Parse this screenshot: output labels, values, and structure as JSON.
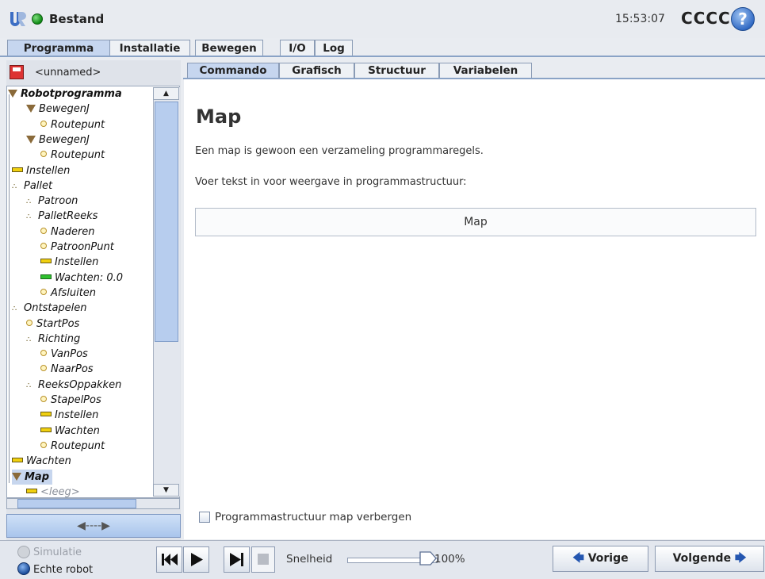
{
  "header": {
    "app_title": "Bestand",
    "clock": "15:53:07",
    "robot_name": "CCCC",
    "help_symbol": "?"
  },
  "main_tabs": [
    {
      "label": "Programma",
      "active": true
    },
    {
      "label": "Installatie",
      "active": false
    },
    {
      "label": "Bewegen",
      "active": false
    },
    {
      "label": "I/O",
      "active": false
    },
    {
      "label": "Log",
      "active": false
    }
  ],
  "program": {
    "name": "<unnamed>"
  },
  "tree": [
    {
      "label": "Robotprogramma",
      "icon": "triangle-icon",
      "bold": true
    },
    {
      "label": "BewegenJ",
      "icon": "triangle-icon"
    },
    {
      "label": "Routepunt",
      "icon": "waypoint-icon"
    },
    {
      "label": "BewegenJ",
      "icon": "triangle-icon"
    },
    {
      "label": "Routepunt",
      "icon": "waypoint-icon"
    },
    {
      "label": "Instellen",
      "icon": "set-icon"
    },
    {
      "label": "Pallet",
      "icon": "pallet-icon"
    },
    {
      "label": "Patroon",
      "icon": "pallet-icon"
    },
    {
      "label": "PalletReeks",
      "icon": "pallet-icon"
    },
    {
      "label": "Naderen",
      "icon": "waypoint-icon"
    },
    {
      "label": "PatroonPunt",
      "icon": "waypoint-icon"
    },
    {
      "label": "Instellen",
      "icon": "set-icon"
    },
    {
      "label": "Wachten: 0.0",
      "icon": "wait-icon"
    },
    {
      "label": "Afsluiten",
      "icon": "waypoint-icon"
    },
    {
      "label": "Ontstapelen",
      "icon": "pallet-icon"
    },
    {
      "label": "StartPos",
      "icon": "waypoint-icon"
    },
    {
      "label": "Richting",
      "icon": "pallet-icon"
    },
    {
      "label": "VanPos",
      "icon": "waypoint-icon"
    },
    {
      "label": "NaarPos",
      "icon": "waypoint-icon"
    },
    {
      "label": "ReeksOppakken",
      "icon": "pallet-icon"
    },
    {
      "label": "StapelPos",
      "icon": "waypoint-icon"
    },
    {
      "label": "Instellen",
      "icon": "set-icon"
    },
    {
      "label": "Wachten",
      "icon": "set-icon"
    },
    {
      "label": "Routepunt",
      "icon": "waypoint-icon"
    },
    {
      "label": "Wachten",
      "icon": "set-icon"
    },
    {
      "label": "Map",
      "icon": "triangle-icon",
      "bold": true,
      "selected": true
    },
    {
      "label": "<leeg>",
      "icon": "set-icon",
      "muted": true
    }
  ],
  "move_button_symbol": "◀----▶",
  "sub_tabs": [
    {
      "label": "Commando",
      "active": true
    },
    {
      "label": "Grafisch",
      "active": false
    },
    {
      "label": "Structuur",
      "active": false
    },
    {
      "label": "Variabelen",
      "active": false
    }
  ],
  "content": {
    "title": "Map",
    "description": "Een map is gewoon een verzameling programmaregels.",
    "prompt": "Voer tekst in voor weergave in programmastructuur:",
    "comment_value": "Map",
    "hide_checkbox_label": "Programmastructuur map verbergen",
    "hide_checked": false
  },
  "footer": {
    "simulation_label": "Simulatie",
    "real_robot_label": "Echte robot",
    "real_robot_selected": true,
    "speed_label": "Snelheid",
    "speed_value": "100%",
    "speed_fraction": 1.0,
    "prev_label": "Vorige",
    "next_label": "Volgende",
    "accent_color": "#2456b0"
  }
}
